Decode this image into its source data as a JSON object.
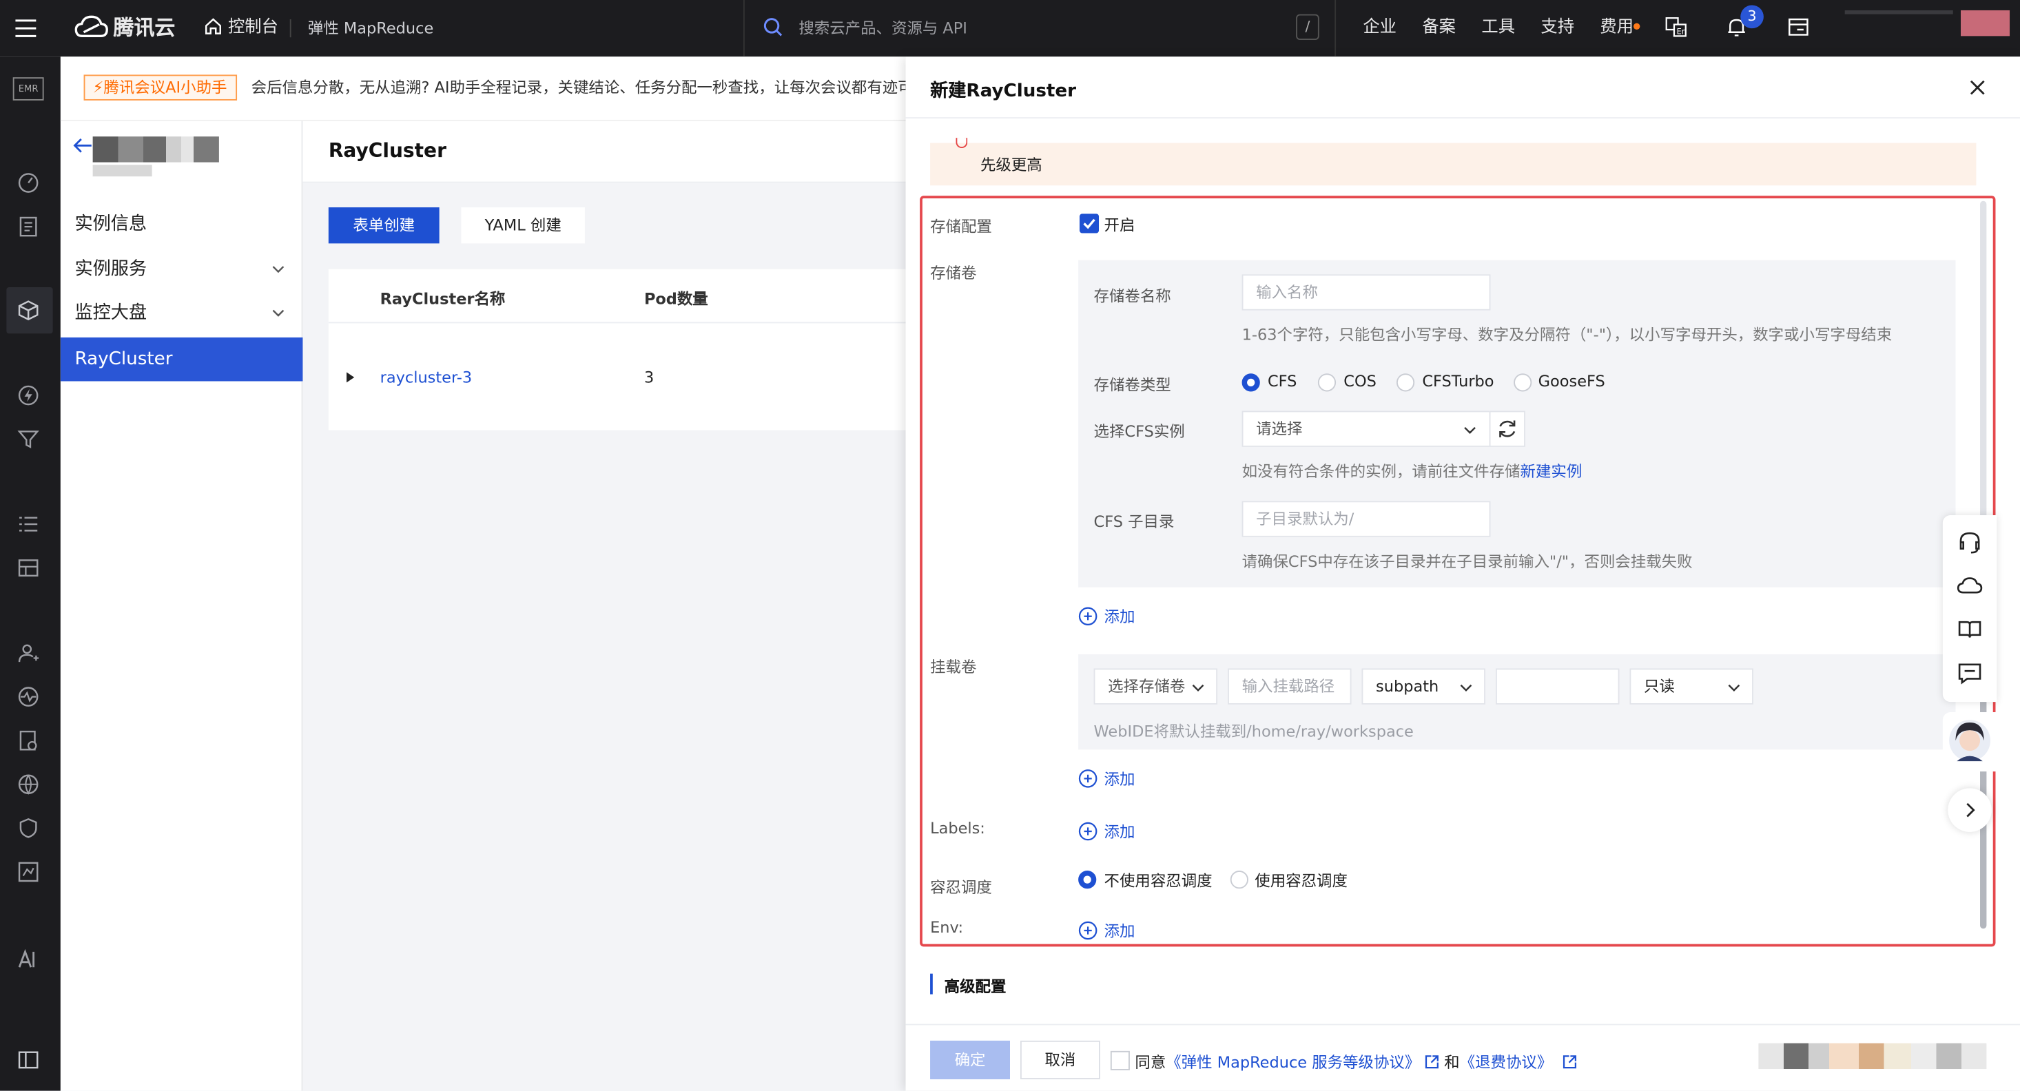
{
  "topbar": {
    "brand": "腾讯云",
    "console": "控制台",
    "product": "弹性 MapReduce",
    "search_placeholder": "搜索云产品、资源与 API",
    "search_shortcut": "/",
    "nav": [
      "企业",
      "备案",
      "工具",
      "支持",
      "费用"
    ],
    "notification_count": "3",
    "colors": {
      "bg": "#1c1c1f",
      "accent": "#1e50d2"
    }
  },
  "rail": {
    "product_icon": "EMR"
  },
  "notice": {
    "badge": "腾讯会议AI小助手",
    "text": "会后信息分散，无从追溯? AI助手全程记录，关键结论、任务分配一秒查找，让每次会议都有迹可循"
  },
  "sidebar": {
    "items": [
      {
        "label": "实例信息"
      },
      {
        "label": "实例服务"
      },
      {
        "label": "监控大盘"
      },
      {
        "label": "RayCluster"
      }
    ]
  },
  "main": {
    "title": "RayCluster",
    "create_form_btn": "表单创建",
    "create_yaml_btn": "YAML 创建",
    "table": {
      "headers": [
        "RayCluster名称",
        "Pod数量"
      ],
      "rows": [
        {
          "name": "raycluster-3",
          "pods": "3"
        }
      ]
    }
  },
  "drawer": {
    "title": "新建RayCluster",
    "warning_tail": "先级更高",
    "storage": {
      "config_label": "存储配置",
      "enable_label": "开启",
      "volume_label": "存储卷",
      "name_label": "存储卷名称",
      "name_placeholder": "输入名称",
      "name_hint": "1-63个字符，只能包含小写字母、数字及分隔符（\"-\"），以小写字母开头，数字或小写字母结束",
      "type_label": "存储卷类型",
      "types": [
        "CFS",
        "COS",
        "CFSTurbo",
        "GooseFS"
      ],
      "cfs_instance_label": "选择CFS实例",
      "cfs_instance_placeholder": "请选择",
      "cfs_hint_prefix": "如没有符合条件的实例，请前往文件存储",
      "cfs_hint_link": "新建实例",
      "subdir_label": "CFS 子目录",
      "subdir_placeholder": "子目录默认为/",
      "subdir_hint": "请确保CFS中存在该子目录并在子目录前输入\"/\"，否则会挂载失败",
      "add_label": "添加"
    },
    "mount": {
      "label": "挂载卷",
      "select_volume": "选择存储卷",
      "path_placeholder": "输入挂载路径",
      "subpath": "subpath",
      "mode": "只读",
      "hint": "WebIDE将默认挂载到/home/ray/workspace",
      "add_label": "添加"
    },
    "labels": {
      "label": "Labels:",
      "add_label": "添加"
    },
    "toleration": {
      "label": "容忍调度",
      "options": [
        "不使用容忍调度",
        "使用容忍调度"
      ]
    },
    "env": {
      "label": "Env:",
      "add_label": "添加"
    },
    "advanced": "高级配置",
    "footer": {
      "confirm": "确定",
      "cancel": "取消",
      "agree_prefix": "同意",
      "agreement1": "《弹性 MapReduce 服务等级协议》",
      "and": "和",
      "agreement2": "《退费协议》"
    }
  }
}
